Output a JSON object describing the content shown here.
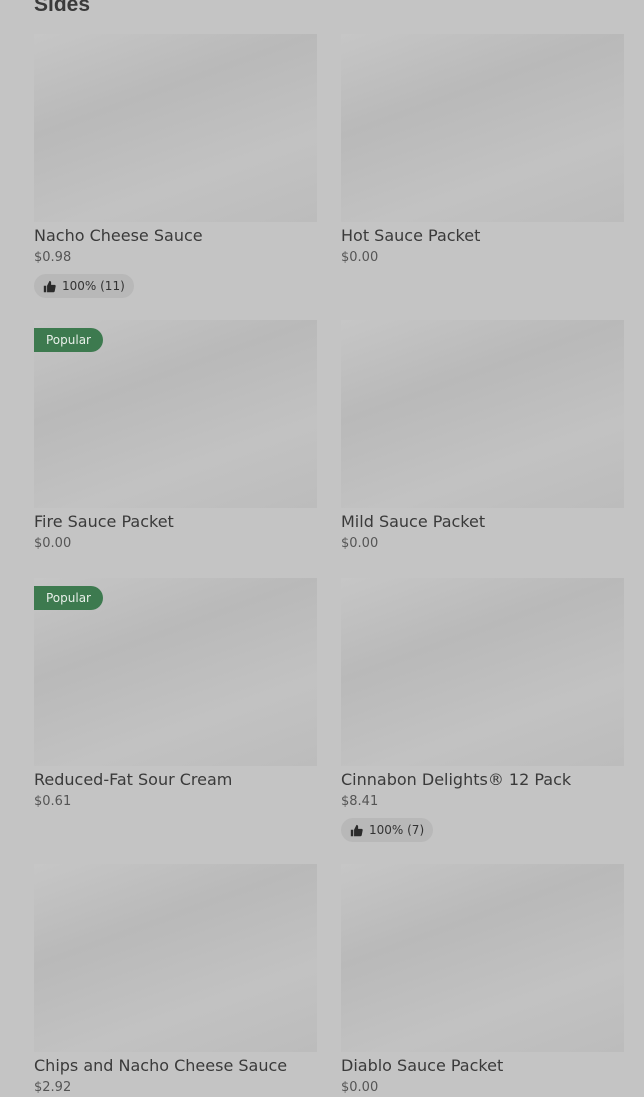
{
  "section": {
    "title": "Sides"
  },
  "items": [
    {
      "name": "Nacho Cheese Sauce",
      "price": "$0.98",
      "rating": "100% (11)",
      "badge": ""
    },
    {
      "name": "Hot Sauce Packet",
      "price": "$0.00",
      "rating": "",
      "badge": ""
    },
    {
      "name": "Fire Sauce Packet",
      "price": "$0.00",
      "rating": "",
      "badge": "Popular"
    },
    {
      "name": "Mild Sauce Packet",
      "price": "$0.00",
      "rating": "",
      "badge": ""
    },
    {
      "name": "Reduced-Fat Sour Cream",
      "price": "$0.61",
      "rating": "",
      "badge": "Popular"
    },
    {
      "name": "Cinnabon Delights® 12 Pack",
      "price": "$8.41",
      "rating": "100% (7)",
      "badge": ""
    },
    {
      "name": "Chips and Nacho Cheese Sauce",
      "price": "$2.92",
      "rating": "",
      "badge": ""
    },
    {
      "name": "Diablo Sauce Packet",
      "price": "$0.00",
      "rating": "",
      "badge": ""
    }
  ],
  "icons": {
    "rating": "thumbs-up-icon"
  },
  "colors": {
    "badge": "#3d7a4f",
    "background": "#c4c4c4"
  }
}
